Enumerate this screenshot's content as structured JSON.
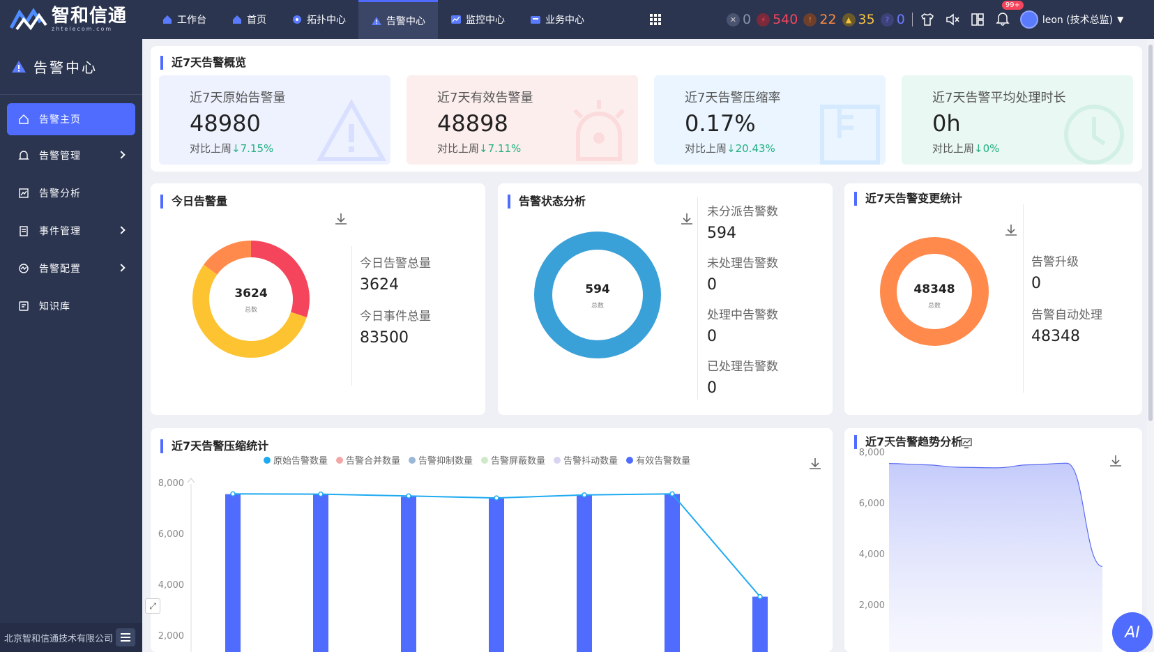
{
  "topbar": {
    "logo_cn": "智和信通",
    "logo_en": "zhtelecom.com",
    "nav": [
      {
        "label": "工作台",
        "icon": "home-icon"
      },
      {
        "label": "首页",
        "icon": "home-icon"
      },
      {
        "label": "拓扑中心",
        "icon": "topology-icon"
      },
      {
        "label": "告警中心",
        "icon": "warning-icon",
        "active": true
      },
      {
        "label": "监控中心",
        "icon": "monitor-icon"
      },
      {
        "label": "业务中心",
        "icon": "business-icon"
      }
    ],
    "status_counts": [
      {
        "name": "unknown",
        "value": "0",
        "color": "#8a93a8"
      },
      {
        "name": "critical",
        "value": "540",
        "color": "#f5455c"
      },
      {
        "name": "major",
        "value": "22",
        "color": "#ff8a3d"
      },
      {
        "name": "minor",
        "value": "35",
        "color": "#f5c242"
      },
      {
        "name": "info",
        "value": "0",
        "color": "#6c7bff"
      }
    ],
    "notification_badge": "99+",
    "user": "leon (技术总监)"
  },
  "sidebar": {
    "title": "告警中心",
    "items": [
      {
        "label": "告警主页",
        "active": true
      },
      {
        "label": "告警管理",
        "chevron": true
      },
      {
        "label": "告警分析"
      },
      {
        "label": "事件管理",
        "chevron": true
      },
      {
        "label": "告警配置",
        "chevron": true
      },
      {
        "label": "知识库"
      }
    ],
    "footer": "北京智和信通技术有限公司"
  },
  "overview": {
    "title": "近7天告警概览",
    "kpis": [
      {
        "label": "近7天原始告警量",
        "value": "48980",
        "cmp_prefix": "对比上周",
        "cmp": "↓7.15%",
        "bg": "#eef2ff"
      },
      {
        "label": "近7天有效告警量",
        "value": "48898",
        "cmp_prefix": "对比上周",
        "cmp": "↓7.11%",
        "bg": "#fdeeee"
      },
      {
        "label": "近7天告警压缩率",
        "value": "0.17%",
        "cmp_prefix": "对比上周",
        "cmp": "↓20.43%",
        "bg": "#eaf5ff"
      },
      {
        "label": "近7天告警平均处理时长",
        "value": "0h",
        "cmp_prefix": "对比上周",
        "cmp": "↓0%",
        "bg": "#eaf8f3"
      }
    ]
  },
  "today": {
    "title": "今日告警量",
    "center_value": "3624",
    "center_label": "总数",
    "stats": [
      {
        "label": "今日告警总量",
        "value": "3624"
      },
      {
        "label": "今日事件总量",
        "value": "83500"
      }
    ],
    "slices": [
      {
        "value": 0.3,
        "color": "#f5455c"
      },
      {
        "value": 0.55,
        "color": "#fdc331"
      },
      {
        "value": 0.15,
        "color": "#ff8a4c"
      }
    ]
  },
  "status_analysis": {
    "title": "告警状态分析",
    "center_value": "594",
    "center_label": "总数",
    "stats": [
      {
        "label": "未分派告警数",
        "value": "594"
      },
      {
        "label": "未处理告警数",
        "value": "0"
      },
      {
        "label": "处理中告警数",
        "value": "0"
      },
      {
        "label": "已处理告警数",
        "value": "0"
      }
    ],
    "ring_color": "#3aa0d8"
  },
  "change_stats": {
    "title": "近7天告警变更统计",
    "center_value": "48348",
    "center_label": "总数",
    "stats": [
      {
        "label": "告警升级",
        "value": "0"
      },
      {
        "label": "告警自动处理",
        "value": "48348"
      }
    ],
    "ring_color": "#ff8a4c"
  },
  "compression": {
    "title": "近7天告警压缩统计",
    "legend": [
      {
        "label": "原始告警数量",
        "color": "#1eaaf1"
      },
      {
        "label": "告警合并数量",
        "color": "#f4a6a6"
      },
      {
        "label": "告警抑制数量",
        "color": "#9ab8d6"
      },
      {
        "label": "告警屏蔽数量",
        "color": "#cfe8c8"
      },
      {
        "label": "告警抖动数量",
        "color": "#d8d3f0"
      },
      {
        "label": "有效告警数量",
        "color": "#4f6cff"
      }
    ],
    "y_ticks": [
      "8,000",
      "6,000",
      "4,000",
      "2,000"
    ]
  },
  "trend": {
    "title": "近7天告警趋势分析",
    "y_ticks": [
      "8,000",
      "6,000",
      "4,000",
      "2,000"
    ]
  },
  "chart_data": [
    {
      "type": "bar",
      "title": "近7天告警压缩统计",
      "ylim": [
        0,
        8500
      ],
      "series": [
        {
          "name": "有效告警数量",
          "values": [
            7550,
            7550,
            7450,
            7380,
            7500,
            7560,
            3520
          ]
        },
        {
          "name": "原始告警数量",
          "values": [
            7560,
            7550,
            7480,
            7400,
            7520,
            7560,
            3520
          ]
        }
      ]
    },
    {
      "type": "area",
      "title": "近7天告警趋势分析",
      "ylim": [
        0,
        8500
      ],
      "series": [
        {
          "values": [
            7550,
            7500,
            7400,
            7380,
            7500,
            7560,
            3500
          ]
        }
      ]
    }
  ]
}
